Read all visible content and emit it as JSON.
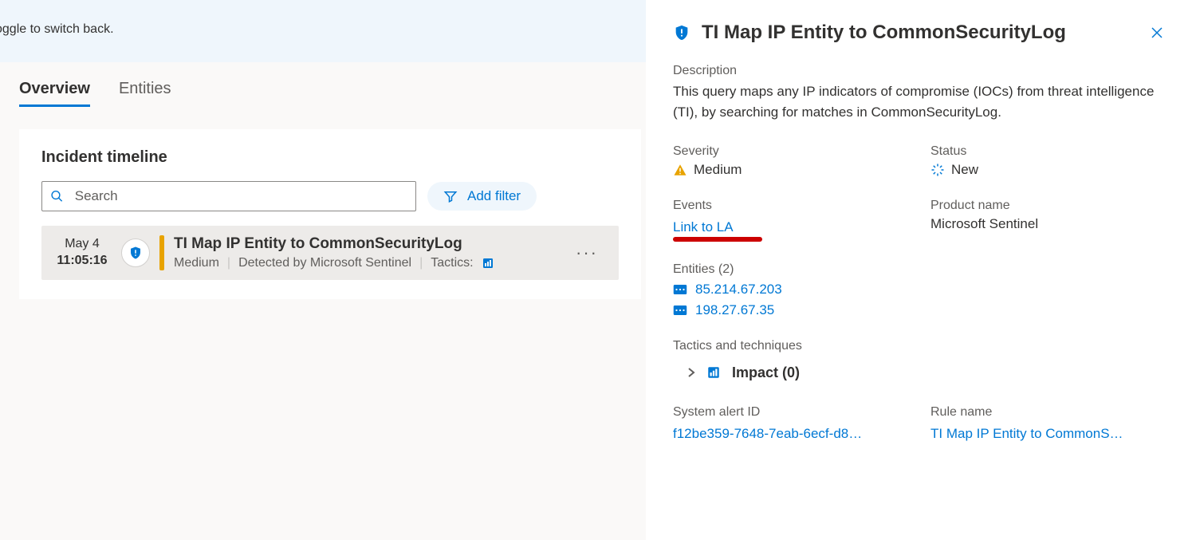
{
  "banner": {
    "text": "oggle to switch back."
  },
  "tabs": {
    "overview": "Overview",
    "entities": "Entities"
  },
  "timeline": {
    "heading": "Incident timeline",
    "search_placeholder": "Search",
    "add_filter": "Add filter",
    "item": {
      "date": "May 4",
      "time": "11:05:16",
      "title": "TI Map IP Entity to CommonSecurityLog",
      "severity": "Medium",
      "detected_by": "Detected by Microsoft Sentinel",
      "tactics_label": "Tactics:"
    }
  },
  "panel": {
    "title": "TI Map IP Entity to CommonSecurityLog",
    "description_label": "Description",
    "description": "This query maps any IP indicators of compromise (IOCs) from threat intelligence (TI), by searching for matches in CommonSecurityLog.",
    "severity_label": "Severity",
    "severity": "Medium",
    "status_label": "Status",
    "status": "New",
    "events_label": "Events",
    "events_link": "Link to LA",
    "product_label": "Product name",
    "product": "Microsoft Sentinel",
    "entities_label": "Entities (2)",
    "entities": [
      "85.214.67.203",
      "198.27.67.35"
    ],
    "tactics_label": "Tactics and techniques",
    "tactic_name": "Impact (0)",
    "alert_id_label": "System alert ID",
    "alert_id": "f12be359-7648-7eab-6ecf-d8…",
    "rule_label": "Rule name",
    "rule_name": "TI Map IP Entity to CommonS…"
  }
}
